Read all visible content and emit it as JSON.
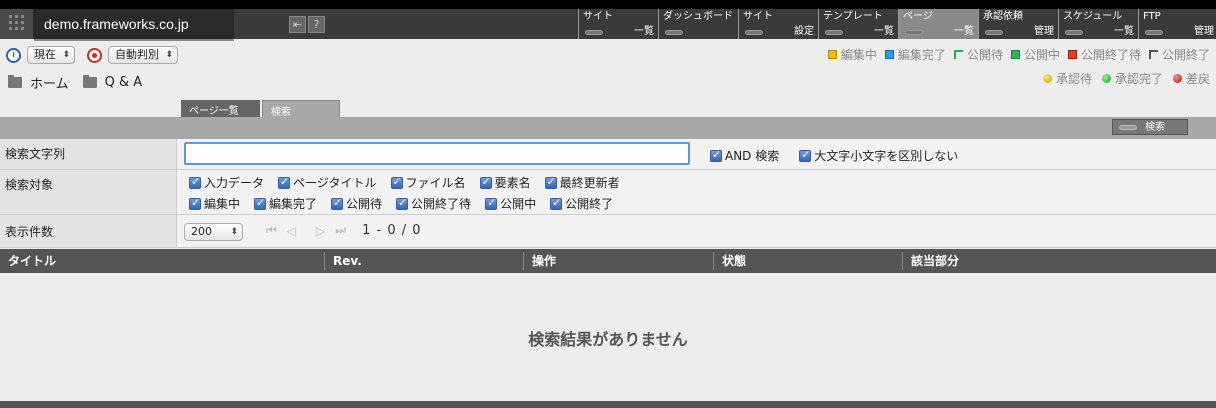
{
  "header": {
    "site_title": "demo.frameworks.co.jp",
    "nav": [
      {
        "top": "サイト",
        "bottom": "一覧",
        "active": false
      },
      {
        "top": "ダッシュボード",
        "bottom": "",
        "active": false
      },
      {
        "top": "サイト",
        "bottom": "設定",
        "active": false
      },
      {
        "top": "テンプレート",
        "bottom": "一覧",
        "active": false
      },
      {
        "top": "ページ",
        "bottom": "一覧",
        "active": true
      },
      {
        "top": "承認依頼",
        "bottom": "管理",
        "active": false
      },
      {
        "top": "スケジュール",
        "bottom": "一覧",
        "active": false
      },
      {
        "top": "FTP",
        "bottom": "管理",
        "active": false
      }
    ]
  },
  "controls": {
    "time_select": "現在",
    "judge_select": "自動判別"
  },
  "breadcrumb": {
    "home": "ホーム",
    "qa": "Q & A"
  },
  "legend": {
    "status": [
      {
        "label": "編集中",
        "color": "#f0c000"
      },
      {
        "label": "編集完了",
        "color": "#1ea0e6"
      },
      {
        "label": "公開待",
        "color": "#22aa44"
      },
      {
        "label": "公開中",
        "color": "#22bb55"
      },
      {
        "label": "公開終了待",
        "color": "#e24020"
      },
      {
        "label": "公開終了",
        "color": "#555555"
      }
    ],
    "approval": [
      {
        "label": "承認待",
        "color": "#e8d000"
      },
      {
        "label": "承認完了",
        "color": "#22cc44"
      },
      {
        "label": "差戻",
        "color": "#d03030"
      }
    ]
  },
  "subtabs": {
    "list": "ページ一覧",
    "search": "検索"
  },
  "search_button": "検索",
  "form": {
    "search_label": "検索文字列",
    "search_value": "",
    "and_search": "AND 検索",
    "case_insensitive": "大文字小文字を区別しない",
    "target_label": "検索対象",
    "targets_row1": [
      "入力データ",
      "ページタイトル",
      "ファイル名",
      "要素名",
      "最終更新者"
    ],
    "targets_row2": [
      "編集中",
      "編集完了",
      "公開待",
      "公開終了待",
      "公開中",
      "公開終了"
    ],
    "count_label": "表示件数",
    "count_value": "200",
    "pager_text": "1 - 0 / 0"
  },
  "table": {
    "columns": [
      "タイトル",
      "Rev.",
      "操作",
      "状態",
      "該当部分"
    ],
    "empty_message": "検索結果がありません"
  }
}
